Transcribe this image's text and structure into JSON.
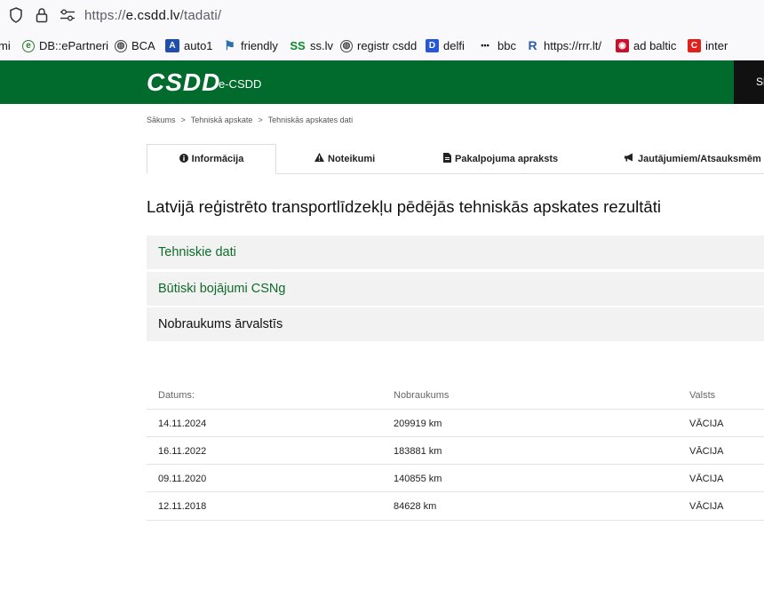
{
  "browser": {
    "url_scheme": "https://",
    "url_host": "e.csdd.lv",
    "url_path": "/tadati/",
    "bookmarks": [
      {
        "label": "mi"
      },
      {
        "label": "DB::ePartneri"
      },
      {
        "label": "BCA"
      },
      {
        "label": "auto1"
      },
      {
        "label": "friendly"
      },
      {
        "label": "ss.lv"
      },
      {
        "label": "registr csdd"
      },
      {
        "label": "delfi"
      },
      {
        "label": "bbc"
      },
      {
        "label": "https://rrr.lt/"
      },
      {
        "label": "ad baltic"
      },
      {
        "label": "inter"
      }
    ]
  },
  "header": {
    "logo": "CSDD",
    "subtitle": "e-CSDD",
    "right_text": "Sl"
  },
  "breadcrumb": [
    "Sākums",
    "Tehniskā apskate",
    "Tehniskās apskates dati"
  ],
  "breadcrumb_sep": ">",
  "tabs": [
    {
      "label": "Informācija",
      "icon": "info-icon"
    },
    {
      "label": "Noteikumi",
      "icon": "warning-icon"
    },
    {
      "label": "Pakalpojuma apraksts",
      "icon": "document-icon"
    },
    {
      "label": "Jautājumiem/Atsauksmēm",
      "icon": "megaphone-icon"
    }
  ],
  "page_title": "Latvijā reģistrēto transportlīdzekļu pēdējās tehniskās apskates rezultāti",
  "sections": [
    {
      "label": "Tehniskie dati"
    },
    {
      "label": "Būtiski bojājumi CSNg"
    },
    {
      "label": "Nobraukums ārvalstīs"
    }
  ],
  "table": {
    "headers": [
      "Datums:",
      "Nobraukums",
      "Valsts"
    ],
    "rows": [
      [
        "14.11.2024",
        "209919 km",
        "VĀCIJA"
      ],
      [
        "16.11.2022",
        "183881 km",
        "VĀCIJA"
      ],
      [
        "09.11.2020",
        "140855 km",
        "VĀCIJA"
      ],
      [
        "12.11.2018",
        "84628 km",
        "VĀCIJA"
      ]
    ]
  },
  "colors": {
    "brand_green": "#006b2d",
    "link_green": "#0f6b2a"
  }
}
